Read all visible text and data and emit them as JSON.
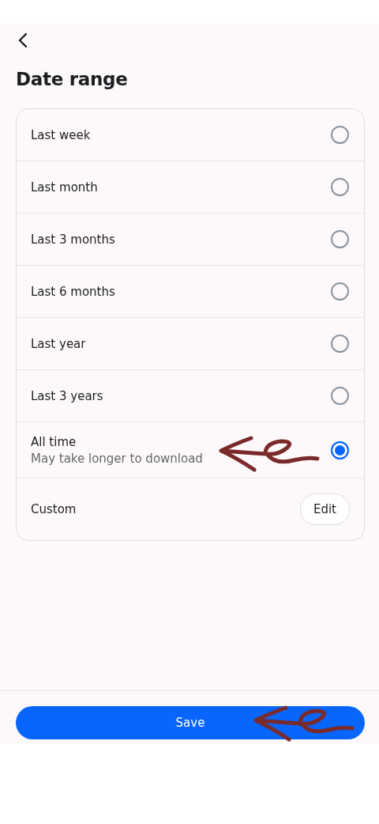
{
  "header": {
    "title": "Date range"
  },
  "options": [
    {
      "label": "Last week",
      "selected": false,
      "kind": "radio"
    },
    {
      "label": "Last month",
      "selected": false,
      "kind": "radio"
    },
    {
      "label": "Last 3 months",
      "selected": false,
      "kind": "radio"
    },
    {
      "label": "Last 6 months",
      "selected": false,
      "kind": "radio"
    },
    {
      "label": "Last year",
      "selected": false,
      "kind": "radio"
    },
    {
      "label": "Last 3 years",
      "selected": false,
      "kind": "radio"
    },
    {
      "label": "All time",
      "sublabel": "May take longer to download",
      "selected": true,
      "kind": "radio"
    },
    {
      "label": "Custom",
      "button": "Edit",
      "kind": "button"
    }
  ],
  "save_button": "Save",
  "annotations": [
    {
      "kind": "arrow"
    },
    {
      "kind": "arrow"
    }
  ]
}
